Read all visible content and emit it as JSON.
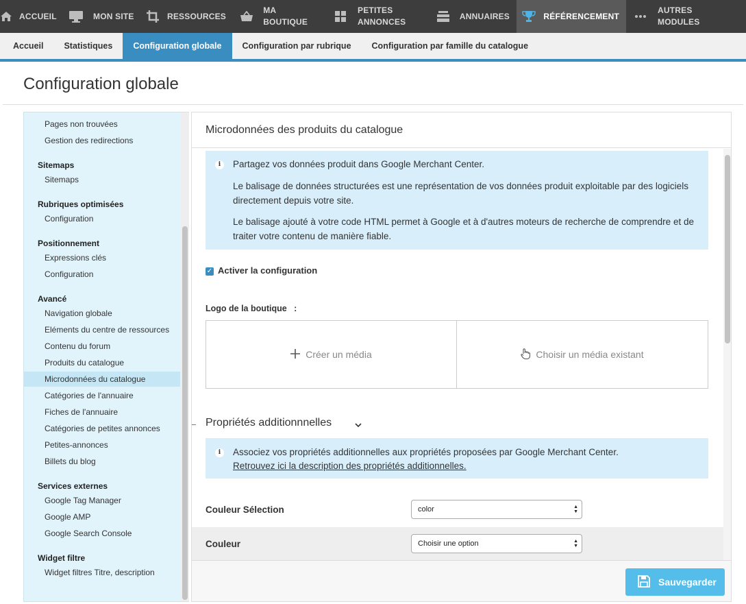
{
  "nav": {
    "items": [
      {
        "label": "ACCUEIL",
        "icon": "home-icon"
      },
      {
        "label": "MON SITE",
        "icon": "monitor-icon"
      },
      {
        "label": "RESSOURCES",
        "icon": "crop-icon"
      },
      {
        "label": "MA BOUTIQUE",
        "icon": "basket-icon"
      },
      {
        "label": "PETITES ANNONCES",
        "icon": "grid-icon"
      },
      {
        "label": "ANNUAIRES",
        "icon": "stack-icon"
      },
      {
        "label": "RÉFÉRENCEMENT",
        "icon": "trophy-icon"
      },
      {
        "label": "AUTRES MODULES",
        "icon": "dots-icon"
      }
    ],
    "active_index": 6
  },
  "subtabs": [
    "Accueil",
    "Statistiques",
    "Configuration globale",
    "Configuration par rubrique",
    "Configuration par famille du catalogue"
  ],
  "page": {
    "title": "Configuration globale"
  },
  "sidebar": {
    "top_items": [
      "Pages non trouvées",
      "Gestion des redirections"
    ],
    "groups": [
      {
        "title": "Sitemaps",
        "items": [
          "Sitemaps"
        ]
      },
      {
        "title": "Rubriques optimisées",
        "items": [
          "Configuration"
        ]
      },
      {
        "title": "Positionnement",
        "items": [
          "Expressions clés",
          "Configuration"
        ]
      },
      {
        "title": "Avancé",
        "items": [
          "Navigation globale",
          "Eléments du centre de ressources",
          "Contenu du forum",
          "Produits du catalogue",
          "Microdonnées du catalogue",
          "Catégories de l'annuaire",
          "Fiches de l'annuaire",
          "Catégories de petites annonces",
          "Petites-annonces",
          "Billets du blog"
        ]
      },
      {
        "title": "Services externes",
        "items": [
          "Google Tag Manager",
          "Google AMP",
          "Google Search Console"
        ]
      },
      {
        "title": "Widget filtre",
        "items": [
          "Widget filtres Titre, description"
        ]
      }
    ],
    "active_item": "Microdonnées du catalogue"
  },
  "main": {
    "title": "Microdonnées des produits du catalogue",
    "info": {
      "line1": "Partagez vos données produit dans Google Merchant Center.",
      "line2": "Le balisage de données structurées est une représentation de vos données produit exploitable par des logiciels directement depuis votre site.",
      "line3": "Le balisage ajouté à votre code HTML permet à Google et à d'autres moteurs de recherche de comprendre et de traiter votre contenu de manière fiable."
    },
    "checkbox_label": "Activer la configuration",
    "logo_label": "Logo de la boutique",
    "logo_colon": ":",
    "create_media": "Créer un média",
    "choose_media": "Choisir un média existant",
    "section_title": "Propriétés additionnnelles",
    "info2": {
      "line1": "Associez vos propriétés additionnelles aux propriétés proposées par Google Merchant Center.",
      "link": "Retrouvez ici la description des propriétés additionnelles."
    },
    "fields": [
      {
        "label": "Couleur Sélection",
        "value": "color"
      },
      {
        "label": "Couleur",
        "value": "Choisir une option"
      }
    ],
    "save_label": "Sauvegarder"
  },
  "colors": {
    "accent": "#3a8dc1",
    "nav_bg": "#3d3d3d",
    "info_bg": "#d8effb",
    "save": "#55bde9"
  }
}
